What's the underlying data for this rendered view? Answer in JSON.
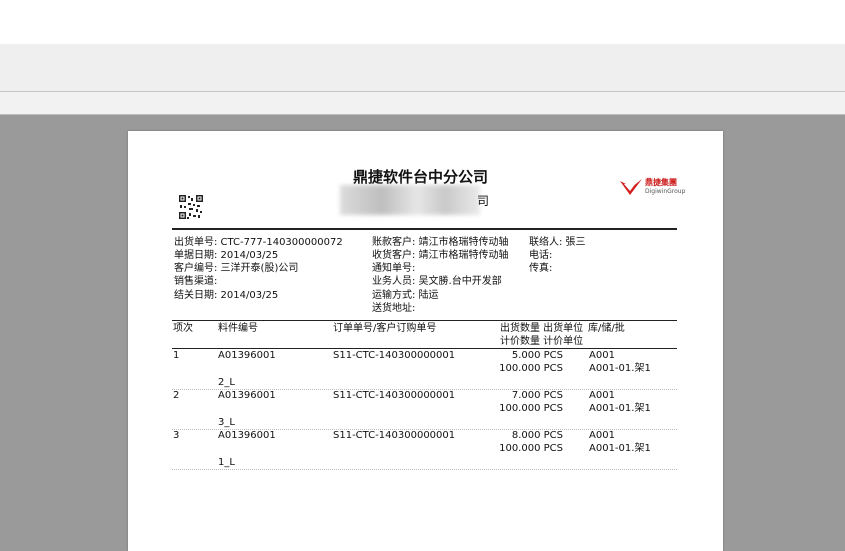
{
  "doc": {
    "title": "鼎捷软件台中分公司",
    "subtitle_visible": "司",
    "logo_cn": "鼎捷集團",
    "logo_en": "DigiwinGroup",
    "info": {
      "shipment_no": "出货单号: CTC-777-140300000072",
      "doc_date": "单据日期: 2014/03/25",
      "customer_no": "客户编号: 三洋开泰(股)公司",
      "sales_channel": "销售渠道:",
      "close_date": "结关日期: 2014/03/25",
      "bill_customer": "账款客户: 靖江市格瑞特传动轴",
      "recv_customer": "收货客户: 靖江市格瑞特传动轴",
      "notify_no": "通知单号:",
      "salesperson": "业务人员: 吴文勝.台中开发部",
      "ship_method": "运输方式: 陆运",
      "delivery_addr": "送货地址:",
      "contact": "联络人:   張三",
      "phone": "电话:",
      "fax": "传真:"
    },
    "headers": {
      "item_no": "项次",
      "part_no": "料件编号",
      "order_no": "订单单号/客户订购单号",
      "ship_qty_top": "出货数量 出货单位",
      "ship_qty_bottom": "计价数量 计价单位",
      "location": "库/储/批"
    },
    "rows": [
      {
        "no": "1",
        "part": "A01396001",
        "part2": "2_L",
        "order": "S11-CTC-140300000001",
        "qty1": "5.000 PCS",
        "qty2": "100.000 PCS",
        "loc1": "A001",
        "loc2": "A001-01.架1"
      },
      {
        "no": "2",
        "part": "A01396001",
        "part2": "3_L",
        "order": "S11-CTC-140300000001",
        "qty1": "7.000 PCS",
        "qty2": "100.000 PCS",
        "loc1": "A001",
        "loc2": "A001-01.架1"
      },
      {
        "no": "3",
        "part": "A01396001",
        "part2": "1_L",
        "order": "S11-CTC-140300000001",
        "qty1": "8.000 PCS",
        "qty2": "100.000 PCS",
        "loc1": "A001",
        "loc2": "A001-01.架1"
      }
    ]
  }
}
